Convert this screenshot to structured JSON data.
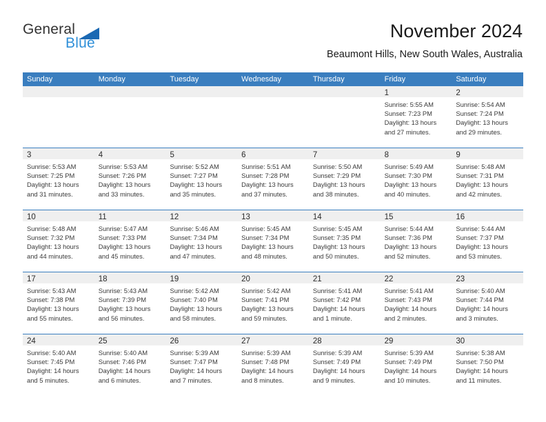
{
  "brand": {
    "name_primary": "General",
    "name_secondary": "Blue",
    "triangle_color": "#1b69b3",
    "secondary_color": "#2f8fd8"
  },
  "header": {
    "month_title": "November 2024",
    "location": "Beaumont Hills, New South Wales, Australia"
  },
  "theme": {
    "header_blue": "#3a7ebf",
    "date_band_gray": "#efefef",
    "text_color": "#3a3a3a"
  },
  "weekdays": [
    "Sunday",
    "Monday",
    "Tuesday",
    "Wednesday",
    "Thursday",
    "Friday",
    "Saturday"
  ],
  "weeks": [
    [
      {
        "day": "",
        "empty": true
      },
      {
        "day": "",
        "empty": true
      },
      {
        "day": "",
        "empty": true
      },
      {
        "day": "",
        "empty": true
      },
      {
        "day": "",
        "empty": true
      },
      {
        "day": "1",
        "sunrise": "Sunrise: 5:55 AM",
        "sunset": "Sunset: 7:23 PM",
        "daylight": "Daylight: 13 hours and 27 minutes."
      },
      {
        "day": "2",
        "sunrise": "Sunrise: 5:54 AM",
        "sunset": "Sunset: 7:24 PM",
        "daylight": "Daylight: 13 hours and 29 minutes."
      }
    ],
    [
      {
        "day": "3",
        "sunrise": "Sunrise: 5:53 AM",
        "sunset": "Sunset: 7:25 PM",
        "daylight": "Daylight: 13 hours and 31 minutes."
      },
      {
        "day": "4",
        "sunrise": "Sunrise: 5:53 AM",
        "sunset": "Sunset: 7:26 PM",
        "daylight": "Daylight: 13 hours and 33 minutes."
      },
      {
        "day": "5",
        "sunrise": "Sunrise: 5:52 AM",
        "sunset": "Sunset: 7:27 PM",
        "daylight": "Daylight: 13 hours and 35 minutes."
      },
      {
        "day": "6",
        "sunrise": "Sunrise: 5:51 AM",
        "sunset": "Sunset: 7:28 PM",
        "daylight": "Daylight: 13 hours and 37 minutes."
      },
      {
        "day": "7",
        "sunrise": "Sunrise: 5:50 AM",
        "sunset": "Sunset: 7:29 PM",
        "daylight": "Daylight: 13 hours and 38 minutes."
      },
      {
        "day": "8",
        "sunrise": "Sunrise: 5:49 AM",
        "sunset": "Sunset: 7:30 PM",
        "daylight": "Daylight: 13 hours and 40 minutes."
      },
      {
        "day": "9",
        "sunrise": "Sunrise: 5:48 AM",
        "sunset": "Sunset: 7:31 PM",
        "daylight": "Daylight: 13 hours and 42 minutes."
      }
    ],
    [
      {
        "day": "10",
        "sunrise": "Sunrise: 5:48 AM",
        "sunset": "Sunset: 7:32 PM",
        "daylight": "Daylight: 13 hours and 44 minutes."
      },
      {
        "day": "11",
        "sunrise": "Sunrise: 5:47 AM",
        "sunset": "Sunset: 7:33 PM",
        "daylight": "Daylight: 13 hours and 45 minutes."
      },
      {
        "day": "12",
        "sunrise": "Sunrise: 5:46 AM",
        "sunset": "Sunset: 7:34 PM",
        "daylight": "Daylight: 13 hours and 47 minutes."
      },
      {
        "day": "13",
        "sunrise": "Sunrise: 5:45 AM",
        "sunset": "Sunset: 7:34 PM",
        "daylight": "Daylight: 13 hours and 48 minutes."
      },
      {
        "day": "14",
        "sunrise": "Sunrise: 5:45 AM",
        "sunset": "Sunset: 7:35 PM",
        "daylight": "Daylight: 13 hours and 50 minutes."
      },
      {
        "day": "15",
        "sunrise": "Sunrise: 5:44 AM",
        "sunset": "Sunset: 7:36 PM",
        "daylight": "Daylight: 13 hours and 52 minutes."
      },
      {
        "day": "16",
        "sunrise": "Sunrise: 5:44 AM",
        "sunset": "Sunset: 7:37 PM",
        "daylight": "Daylight: 13 hours and 53 minutes."
      }
    ],
    [
      {
        "day": "17",
        "sunrise": "Sunrise: 5:43 AM",
        "sunset": "Sunset: 7:38 PM",
        "daylight": "Daylight: 13 hours and 55 minutes."
      },
      {
        "day": "18",
        "sunrise": "Sunrise: 5:43 AM",
        "sunset": "Sunset: 7:39 PM",
        "daylight": "Daylight: 13 hours and 56 minutes."
      },
      {
        "day": "19",
        "sunrise": "Sunrise: 5:42 AM",
        "sunset": "Sunset: 7:40 PM",
        "daylight": "Daylight: 13 hours and 58 minutes."
      },
      {
        "day": "20",
        "sunrise": "Sunrise: 5:42 AM",
        "sunset": "Sunset: 7:41 PM",
        "daylight": "Daylight: 13 hours and 59 minutes."
      },
      {
        "day": "21",
        "sunrise": "Sunrise: 5:41 AM",
        "sunset": "Sunset: 7:42 PM",
        "daylight": "Daylight: 14 hours and 1 minute."
      },
      {
        "day": "22",
        "sunrise": "Sunrise: 5:41 AM",
        "sunset": "Sunset: 7:43 PM",
        "daylight": "Daylight: 14 hours and 2 minutes."
      },
      {
        "day": "23",
        "sunrise": "Sunrise: 5:40 AM",
        "sunset": "Sunset: 7:44 PM",
        "daylight": "Daylight: 14 hours and 3 minutes."
      }
    ],
    [
      {
        "day": "24",
        "sunrise": "Sunrise: 5:40 AM",
        "sunset": "Sunset: 7:45 PM",
        "daylight": "Daylight: 14 hours and 5 minutes."
      },
      {
        "day": "25",
        "sunrise": "Sunrise: 5:40 AM",
        "sunset": "Sunset: 7:46 PM",
        "daylight": "Daylight: 14 hours and 6 minutes."
      },
      {
        "day": "26",
        "sunrise": "Sunrise: 5:39 AM",
        "sunset": "Sunset: 7:47 PM",
        "daylight": "Daylight: 14 hours and 7 minutes."
      },
      {
        "day": "27",
        "sunrise": "Sunrise: 5:39 AM",
        "sunset": "Sunset: 7:48 PM",
        "daylight": "Daylight: 14 hours and 8 minutes."
      },
      {
        "day": "28",
        "sunrise": "Sunrise: 5:39 AM",
        "sunset": "Sunset: 7:49 PM",
        "daylight": "Daylight: 14 hours and 9 minutes."
      },
      {
        "day": "29",
        "sunrise": "Sunrise: 5:39 AM",
        "sunset": "Sunset: 7:49 PM",
        "daylight": "Daylight: 14 hours and 10 minutes."
      },
      {
        "day": "30",
        "sunrise": "Sunrise: 5:38 AM",
        "sunset": "Sunset: 7:50 PM",
        "daylight": "Daylight: 14 hours and 11 minutes."
      }
    ]
  ]
}
